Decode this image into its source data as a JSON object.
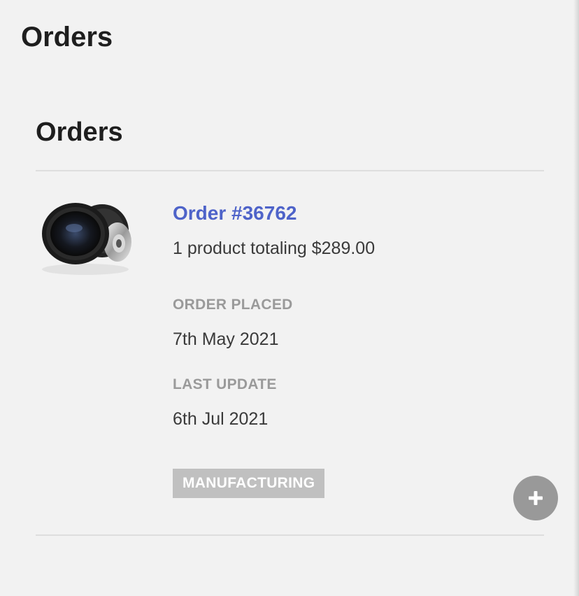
{
  "page": {
    "title": "Orders"
  },
  "orders_section": {
    "title": "Orders",
    "orders": [
      {
        "thumbnail_icon": "subwoofer-product-image",
        "order_label": "Order #36762",
        "summary": "1 product totaling $289.00",
        "placed_label": "ORDER PLACED",
        "placed_value": "7th May 2021",
        "update_label": "LAST UPDATE",
        "update_value": "6th Jul 2021",
        "status": "MANUFACTURING",
        "expand_icon": "plus-icon"
      }
    ]
  },
  "colors": {
    "background": "#f2f2f2",
    "link": "#4e63c9",
    "badge": "#c0c0c0",
    "fab": "#999999"
  }
}
